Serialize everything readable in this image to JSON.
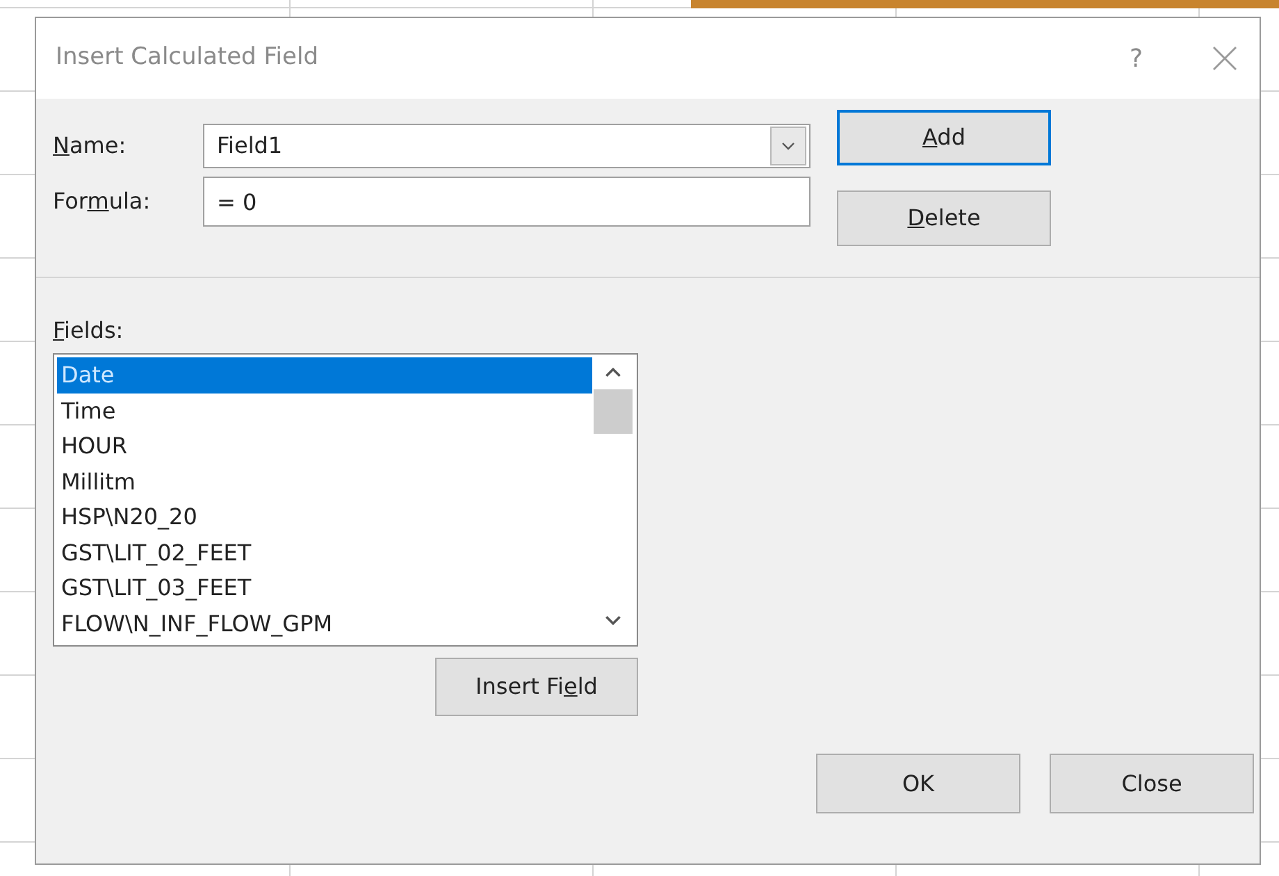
{
  "window": {
    "title": "Insert Calculated Field",
    "help": "?"
  },
  "name_field": {
    "label": [
      {
        "text": "N",
        "underline": true
      },
      {
        "text": "ame:",
        "underline": false
      }
    ],
    "value": "Field1"
  },
  "formula_field": {
    "label": [
      {
        "text": "For",
        "underline": false
      },
      {
        "text": "m",
        "underline": true
      },
      {
        "text": "ula:",
        "underline": false
      }
    ],
    "value": "= 0"
  },
  "side_buttons": [
    {
      "label": [
        {
          "text": "A",
          "underline": true
        },
        {
          "text": "dd",
          "underline": false
        }
      ],
      "default": true
    },
    {
      "label": [
        {
          "text": "D",
          "underline": true
        },
        {
          "text": "elete",
          "underline": false
        }
      ],
      "default": false
    }
  ],
  "fields": {
    "label": [
      {
        "text": "F",
        "underline": true
      },
      {
        "text": "ields:",
        "underline": false
      }
    ],
    "items": [
      {
        "text": "Date",
        "selected": true
      },
      {
        "text": "Time",
        "selected": false
      },
      {
        "text": "HOUR",
        "selected": false
      },
      {
        "text": "Millitm",
        "selected": false
      },
      {
        "text": "HSP\\N20_20",
        "selected": false
      },
      {
        "text": "GST\\LIT_02_FEET",
        "selected": false
      },
      {
        "text": "GST\\LIT_03_FEET",
        "selected": false
      },
      {
        "text": "FLOW\\N_INF_FLOW_GPM",
        "selected": false
      }
    ]
  },
  "insert_button": {
    "label": [
      {
        "text": "Insert Fi",
        "underline": false
      },
      {
        "text": "e",
        "underline": true
      },
      {
        "text": "ld",
        "underline": false
      }
    ]
  },
  "buttons": [
    "OK",
    "Close"
  ]
}
